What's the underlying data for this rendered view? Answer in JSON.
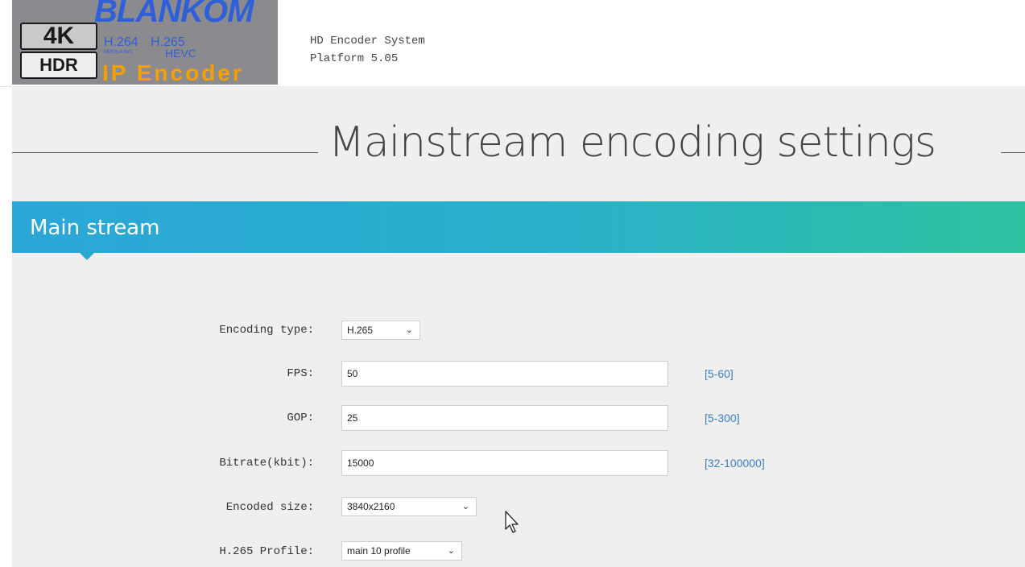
{
  "logo": {
    "brand": "BLANKOM",
    "badge_4k": "4K",
    "badge_hdr": "HDR",
    "codec_264": "H.264",
    "codec_265": "H.265",
    "codec_mpeg": "MPEG-4 AVC",
    "codec_hevc": "HEVC",
    "product": "IP Encoder"
  },
  "header": {
    "system_name": "HD Encoder System",
    "platform": "Platform 5.05"
  },
  "page": {
    "title": "Mainstream encoding settings"
  },
  "section": {
    "title": "Main stream"
  },
  "form": {
    "encoding_type": {
      "label": "Encoding type:",
      "value": "H.265"
    },
    "fps": {
      "label": "FPS:",
      "value": "50",
      "range": "[5-60]"
    },
    "gop": {
      "label": "GOP:",
      "value": "25",
      "range": "[5-300]"
    },
    "bitrate": {
      "label": "Bitrate(kbit):",
      "value": "15000",
      "range": "[32-100000]"
    },
    "encoded_size": {
      "label": "Encoded size:",
      "value": "3840x2160"
    },
    "profile": {
      "label": "H.265 Profile:",
      "value": "main 10 profile"
    }
  },
  "icons": {
    "chevron": "chevron-down-icon",
    "cursor": "mouse-pointer-icon"
  },
  "colors": {
    "header_gradient_start": "#2aa6d8",
    "header_gradient_end": "#2ec19f",
    "range_text": "#3b7fc4",
    "logo_orange": "#f5a000",
    "logo_blue": "#2f5fd9"
  }
}
